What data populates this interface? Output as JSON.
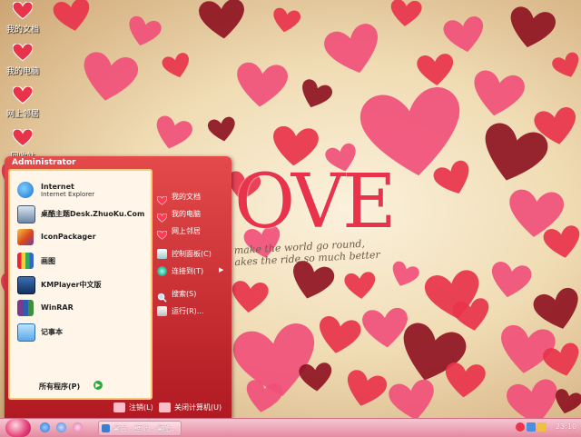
{
  "desktop": {
    "icons": [
      {
        "label": "我的文档",
        "icon": "documents-heart-icon"
      },
      {
        "label": "我的电脑",
        "icon": "computer-heart-icon"
      },
      {
        "label": "网上邻居",
        "icon": "network-heart-icon"
      },
      {
        "label": "回收站",
        "icon": "recycle-bin-heart-icon"
      }
    ],
    "wallpaper": {
      "love_text": "OVE",
      "tagline_line1": "make the world go round,",
      "tagline_line2": "akes the ride so much better"
    }
  },
  "start_menu": {
    "user_name": "Administrator",
    "pinned": [
      {
        "name": "Internet",
        "sub": "Internet Explorer",
        "icon": "internet-explorer-icon"
      },
      {
        "name": "桌酷主题Desk.ZhuoKu.Com",
        "sub": "",
        "icon": "zhuoku-theme-icon"
      },
      {
        "name": "IconPackager",
        "sub": "",
        "icon": "iconpackager-icon"
      },
      {
        "name": "画图",
        "sub": "",
        "icon": "paint-icon"
      },
      {
        "name": "KMPlayer中文版",
        "sub": "",
        "icon": "kmplayer-icon"
      },
      {
        "name": "WinRAR",
        "sub": "",
        "icon": "winrar-icon"
      },
      {
        "name": "记事本",
        "sub": "",
        "icon": "notepad-icon"
      }
    ],
    "all_programs": "所有程序(P)",
    "right_items": [
      {
        "label": "我的文档",
        "icon": "my-documents-heart-icon"
      },
      {
        "label": "我的电脑",
        "icon": "my-computer-heart-icon"
      },
      {
        "label": "网上邻居",
        "icon": "network-places-heart-icon"
      },
      {
        "label": "控制面板(C)",
        "icon": "control-panel-icon"
      },
      {
        "label": "连接到(T)",
        "icon": "connect-to-icon"
      },
      {
        "label": "搜索(S)",
        "icon": "search-icon"
      },
      {
        "label": "运行(R)...",
        "icon": "run-icon"
      }
    ],
    "logoff_label": "注销(L)",
    "shutdown_label": "关闭计算机(U)"
  },
  "taskbar": {
    "task_button_label": "桌面 - 壁纸 - 桌酷...",
    "clock": "23:10"
  },
  "colors": {
    "heart_red": "#e8334b",
    "heart_pink": "#f0507a",
    "heart_dark": "#8e1422",
    "start_menu_red": "#c0222b",
    "taskbar_pink": "#eea3b5"
  }
}
